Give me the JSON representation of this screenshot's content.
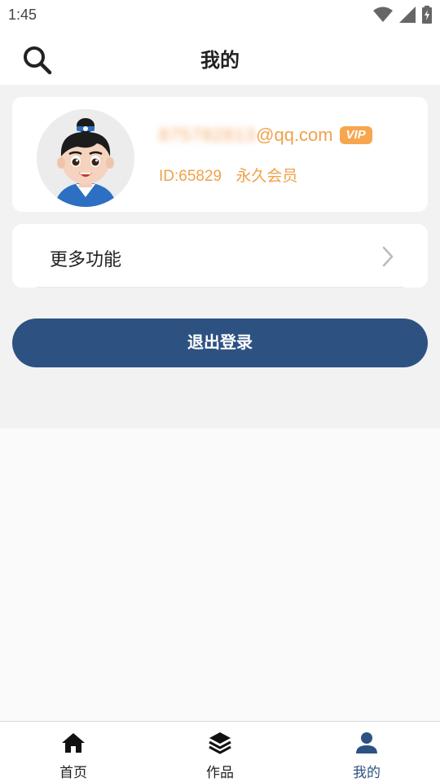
{
  "status_bar": {
    "time": "1:45"
  },
  "header": {
    "title": "我的"
  },
  "profile": {
    "email_blurred": "875782813",
    "email_domain": "@qq.com",
    "vip_label": "VIP",
    "id_text": "ID:65829",
    "membership": "永久会员"
  },
  "menu": {
    "more_functions_label": "更多功能"
  },
  "logout": {
    "label": "退出登录"
  },
  "bottom_nav": {
    "items": [
      {
        "label": "首页",
        "icon": "home-icon"
      },
      {
        "label": "作品",
        "icon": "layers-icon"
      },
      {
        "label": "我的",
        "icon": "person-icon",
        "active": true
      }
    ]
  },
  "colors": {
    "accent": "#2d5282",
    "vip_orange": "#f0a24b"
  }
}
